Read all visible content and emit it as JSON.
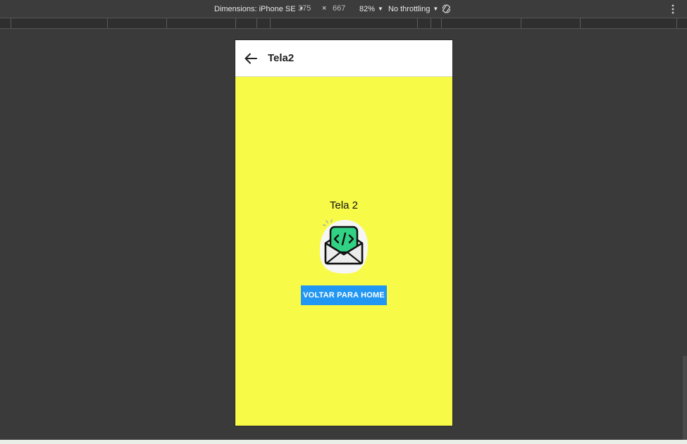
{
  "devtools": {
    "dimensions_label": "Dimensions: iPhone SE",
    "width": "375",
    "times": "×",
    "height": "667",
    "zoom": "82%",
    "throttling": "No throttling"
  },
  "app": {
    "appbar_title": "Tela2",
    "screen_title": "Tela 2",
    "home_button_label": "VOLTAR PARA HOME",
    "background_color": "#f7fa47",
    "button_color": "#2196f3"
  }
}
